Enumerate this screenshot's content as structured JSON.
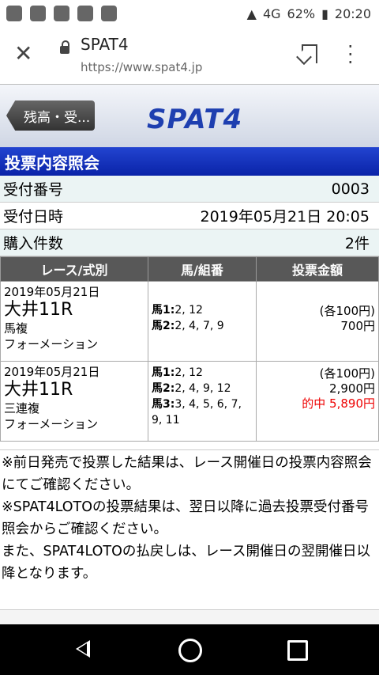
{
  "status_bar": {
    "network": "4G",
    "battery": "62%",
    "time": "20:20"
  },
  "browser": {
    "title": "SPAT4",
    "url": "https://www.spat4.jp"
  },
  "site": {
    "back_label": "残高・受...",
    "logo": "SPAT4"
  },
  "section_title": "投票内容照会",
  "info": {
    "receipt_label": "受付番号",
    "receipt_value": "0003",
    "date_label": "受付日時",
    "date_value": "2019年05月21日 20:05",
    "count_label": "購入件数",
    "count_value": "2件"
  },
  "table": {
    "headers": [
      "レース/式別",
      "馬/組番",
      "投票金額"
    ],
    "rows": [
      {
        "date": "2019年05月21日",
        "race": "大井11R",
        "type": "馬複",
        "method": "フォーメーション",
        "combos": [
          {
            "k": "馬1:",
            "v": "2, 12"
          },
          {
            "k": "馬2:",
            "v": "2, 4, 7, 9"
          }
        ],
        "unit": "(各100円)",
        "amount": "700円",
        "result": ""
      },
      {
        "date": "2019年05月21日",
        "race": "大井11R",
        "type": "三連複",
        "method": "フォーメーション",
        "combos": [
          {
            "k": "馬1:",
            "v": "2, 12"
          },
          {
            "k": "馬2:",
            "v": "2, 4, 9, 12"
          },
          {
            "k": "馬3:",
            "v": "3, 4, 5, 6, 7, 9, 11"
          }
        ],
        "unit": "(各100円)",
        "amount": "2,900円",
        "result": "的中 5,890円"
      }
    ]
  },
  "notes": [
    "※前日発売で投票した結果は、レース開催日の投票内容照会にてご確認ください。",
    "※SPAT4LOTOの投票結果は、翌日以降に過去投票受付番号照会からご確認ください。",
    "また、SPAT4LOTOの払戻しは、レース開催日の翌開催日以降となります。"
  ],
  "colors": {
    "header_blue": "#0a23a8",
    "win_red": "#e00000",
    "row_tint": "#ebf4f4"
  }
}
